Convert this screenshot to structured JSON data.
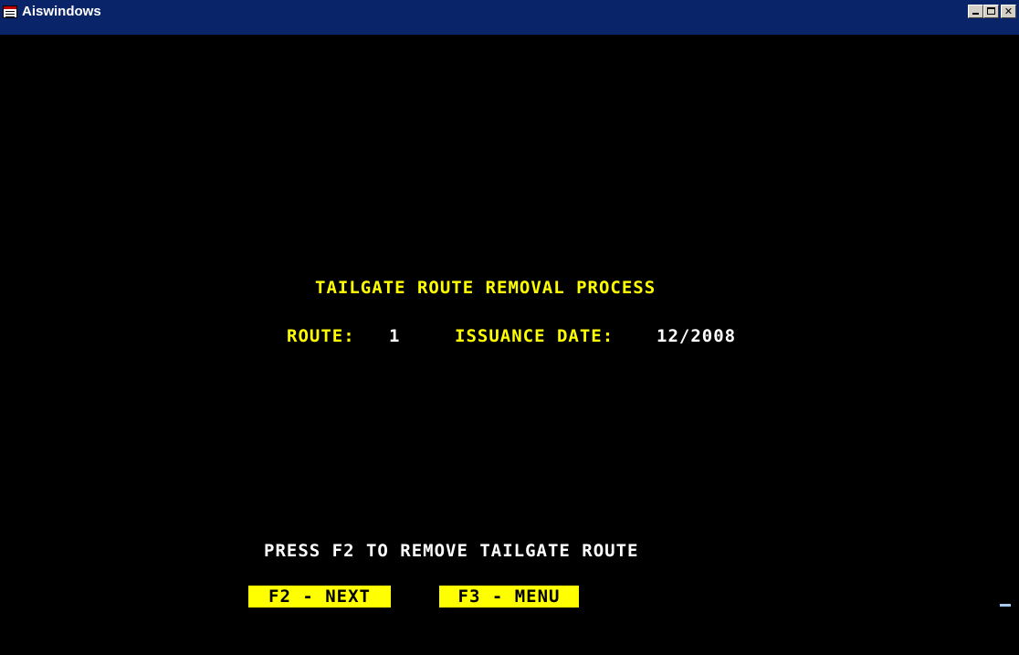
{
  "window": {
    "title": "Aiswindows"
  },
  "screen": {
    "heading": "TAILGATE ROUTE REMOVAL PROCESS",
    "route_label": "ROUTE:",
    "route_value": "1",
    "issuance_label": "ISSUANCE DATE:",
    "issuance_value": "12/2008",
    "instruction": "PRESS F2 TO REMOVE TAILGATE ROUTE"
  },
  "function_keys": [
    {
      "label": "F2 - NEXT"
    },
    {
      "label": "F3 - MENU"
    }
  ],
  "colors": {
    "background": "#000000",
    "label_yellow": "#ffff00",
    "value_white": "#ffffff",
    "titlebar_blue": "#0a246a"
  },
  "icons": {
    "app": "app-window-icon",
    "minimize": "minimize-icon",
    "maximize": "maximize-icon",
    "close": "close-icon"
  }
}
